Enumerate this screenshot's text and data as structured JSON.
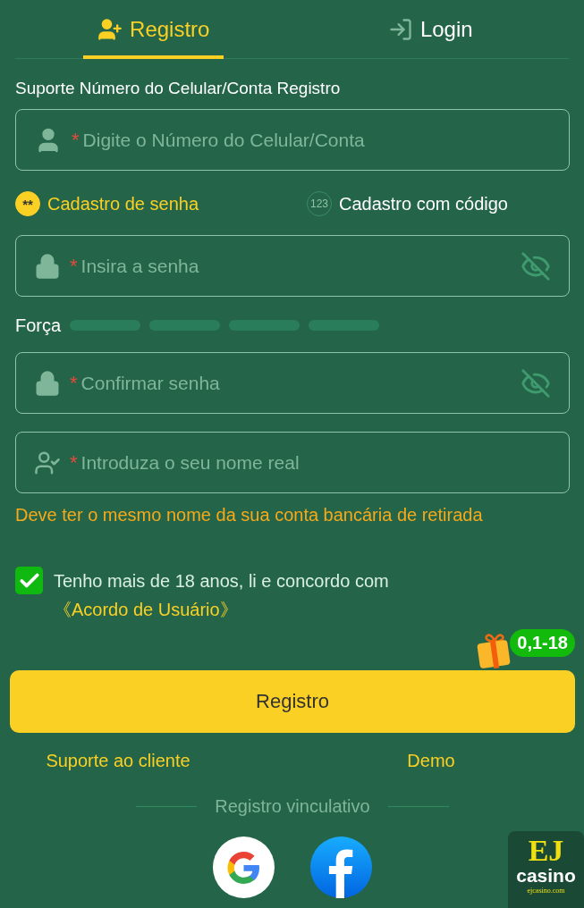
{
  "tabs": [
    {
      "label": "Registro",
      "selected": true,
      "kind": "register"
    },
    {
      "label": "Login",
      "selected": false,
      "kind": "login"
    }
  ],
  "account_label": "Suporte Número do Celular/Conta Registro",
  "account_field": {
    "required_mark": "*",
    "placeholder": "Digite o Número do Celular/Conta"
  },
  "modes": [
    {
      "label": "Cadastro de senha",
      "badge": "**",
      "selected": true
    },
    {
      "label": "Cadastro com código",
      "badge": "123",
      "selected": false
    }
  ],
  "password_field": {
    "required_mark": "*",
    "placeholder": "Insira a senha",
    "hidden": true
  },
  "strength": {
    "label": "Força",
    "segments": [
      {
        "filled": false
      },
      {
        "filled": false
      },
      {
        "filled": false
      },
      {
        "filled": false
      }
    ]
  },
  "confirm_field": {
    "required_mark": "*",
    "placeholder": "Confirmar senha",
    "hidden": true
  },
  "name_field": {
    "required_mark": "*",
    "placeholder": "Introduza o seu nome real"
  },
  "name_hint": "Deve ter o mesmo nome da sua conta bancária de retirada",
  "agreement": {
    "checked": true,
    "text": "Tenho mais de 18 anos, li e concordo com ",
    "link": "《Acordo de Usuário》"
  },
  "gift_badge": "0,1-18",
  "submit": "Registro",
  "links": [
    "Suporte ao cliente",
    "Demo"
  ],
  "social": {
    "title": "Registro vinculativo",
    "providers": [
      {
        "kind": "google"
      },
      {
        "kind": "facebook"
      }
    ]
  },
  "app_logo": {
    "mark": "EJ",
    "name": "casino",
    "domain": "ejcasino.com"
  }
}
